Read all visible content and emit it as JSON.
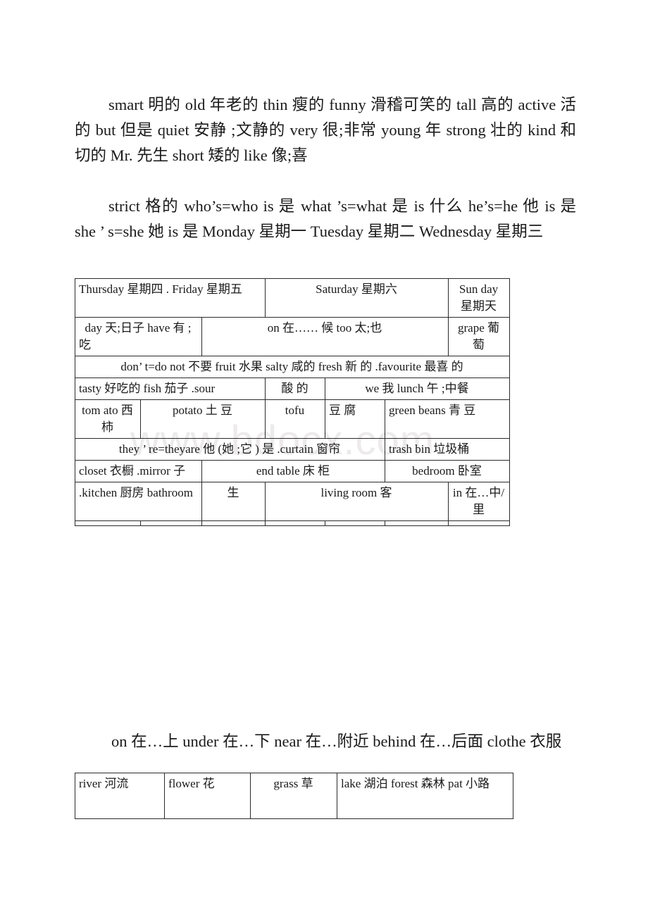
{
  "document": {
    "watermark": "www.bdocx.com",
    "paragraphs": [
      "smart  明的 old 年老的 thin 瘦的 funny 滑稽可笑的 tall 高的 active 活 的 but 但是 quiet 安静 ;文静的 very 很;非常 young 年  strong  壮的 kind 和 切的 Mr. 先生 short 矮的 like 像;喜",
      "strict  格的 who’s=who is 是  what ’s=what 是 is 什么 he’s=he 他 is 是 she ’ s=she 她 is 是 Monday 星期一 Tuesday 星期二 Wednesday 星期三",
      "on 在…上 under 在…下 near 在…附近 behind 在…后面 clothe 衣服"
    ]
  },
  "main_table": {
    "rows": [
      {
        "name": "weekday-row",
        "cells": [
          "Thursday 星期四 . Friday 星期五",
          "Saturday 星期六",
          "Sun day 星期天"
        ]
      },
      {
        "name": "day-have-row",
        "cells": [
          "day 天;日子 have 有 ;吃",
          "on 在…… 候 too 太;也",
          "grape 葡萄"
        ]
      },
      {
        "name": "dont-row",
        "cells": [
          "don’ t=do not 不要 fruit 水果 salty 咸的 fresh 新 的 .favourite 最喜 的"
        ]
      },
      {
        "name": "tasty-row",
        "cells": [
          "tasty 好吃的 fish 茄子 .sour",
          "酸 的",
          "we 我  lunch 午 ;中餐"
        ]
      },
      {
        "name": "tomato-row",
        "cells": [
          "tom ato 西 柿",
          "potato 土 豆",
          "tofu",
          "豆 腐",
          "green beans 青 豆"
        ]
      },
      {
        "name": "theyre-row",
        "cells": [
          "they ’ re=theyare 他 (她 ;它 ) 是 .curtain 窗帘",
          "trash bin 垃圾桶"
        ]
      },
      {
        "name": "closet-row",
        "cells": [
          "closet 衣橱 .mirror  子",
          "end table 床 柜",
          "bedroom 卧室"
        ]
      },
      {
        "name": "kitchen-row",
        "cells": [
          ".kitchen 厨房 bathroom",
          "生",
          "living room 客",
          "in 在…中/里"
        ]
      },
      {
        "name": "empty-row",
        "cells": [
          "",
          "",
          "",
          "",
          "",
          "",
          ""
        ]
      }
    ]
  },
  "bottom_table": {
    "rows": [
      {
        "name": "nature-row",
        "cells": [
          "river 河流",
          "flower 花",
          "grass 草",
          "lake 湖泊 forest 森林 pat 小路"
        ]
      }
    ]
  }
}
